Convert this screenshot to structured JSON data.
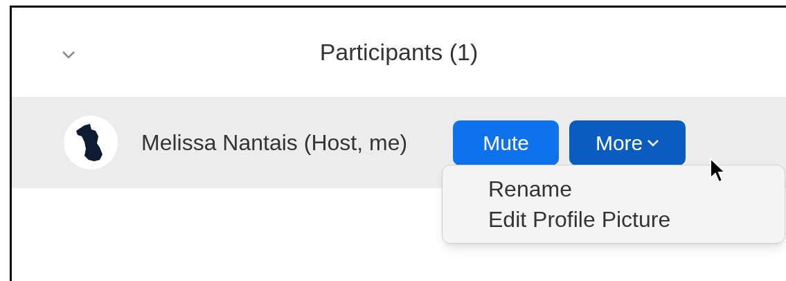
{
  "panel": {
    "title": "Participants (1)"
  },
  "participants": [
    {
      "name": "Melissa Nantais (Host, me)",
      "actions": [
        {
          "label": "Mute",
          "kind": "plain"
        },
        {
          "label": "More",
          "kind": "dropdown"
        }
      ]
    }
  ],
  "menu": {
    "items": [
      "Rename",
      "Edit Profile Picture"
    ]
  }
}
